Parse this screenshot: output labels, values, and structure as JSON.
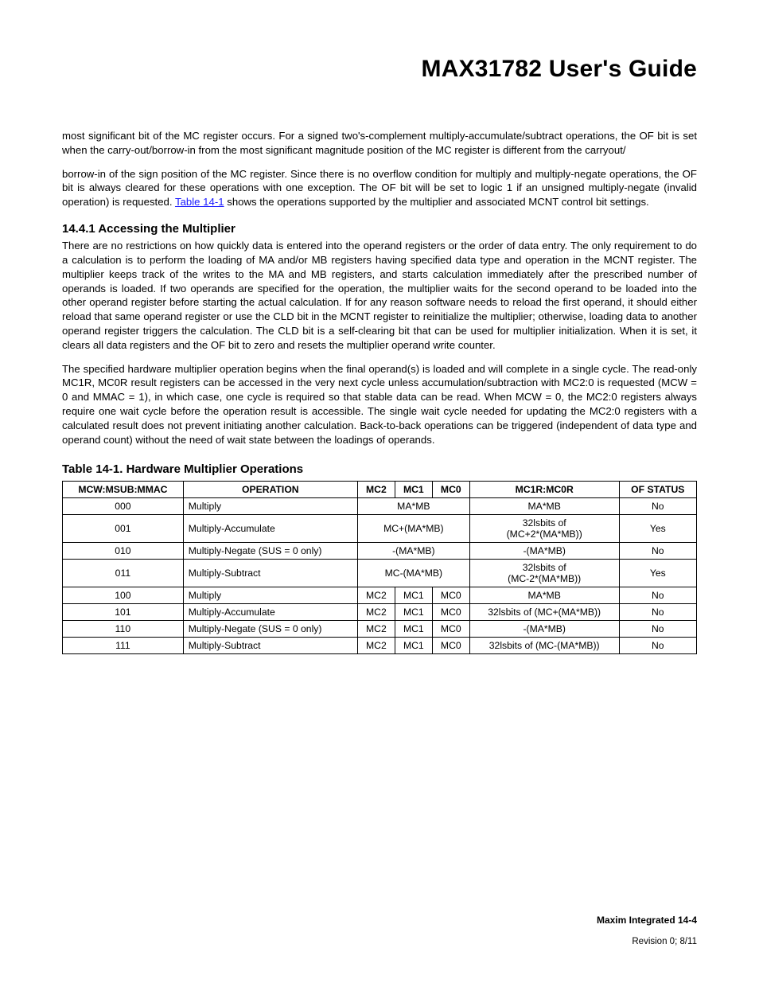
{
  "header": {
    "title": "MAX31782 User's Guide"
  },
  "body": {
    "para1": "most significant bit of the MC register occurs. For a signed two's-complement multiply-accumulate/subtract operations, the OF bit is set when the carry-out/borrow-in from the most significant magnitude position of the MC register is different from the carryout/",
    "para2a": "borrow-in of the sign position of the MC register. Since there is no overflow condition for multiply and multiply-negate operations, the OF bit is always cleared for these operations with one exception. The OF bit will be set to logic 1 if an unsigned multiply-negate (invalid operation) is requested. ",
    "table_link": "Table 14-1",
    "para2b": " shows the operations supported by the multiplier and associated MCNT control bit settings.",
    "section_title": "14.4.1 Accessing the Multiplier",
    "para3": "There are no restrictions on how quickly data is entered into the operand registers or the order of data entry. The only requirement to do a calculation is to perform the loading of MA and/or MB registers having specified data type and operation in the MCNT register. The multiplier keeps track of the writes to the MA and MB registers, and starts calculation immediately after the prescribed number of operands is loaded. If two operands are specified for the operation, the multiplier waits for the second operand to be loaded into the other operand register before starting the actual calculation. If for any reason software needs to reload the first operand, it should either reload that same operand register or use the CLD bit in the MCNT register to reinitialize the multiplier; otherwise, loading data to another operand register triggers the calculation. The CLD bit is a self-clearing bit that can be used for multiplier initialization. When it is set, it clears all data registers and the OF bit to zero and resets the multiplier operand write counter.",
    "para4": "The specified hardware multiplier operation begins when the final operand(s) is loaded and will complete in a single cycle. The read-only MC1R, MC0R result registers can be accessed in the very next cycle unless accumulation/subtraction with MC2:0 is requested (MCW = 0 and MMAC = 1), in which case, one cycle is required so that stable data can be read. When MCW = 0, the MC2:0 registers always require one wait cycle before the operation result is accessible. The single wait cycle needed for updating the MC2:0 registers with a calculated result does not prevent initiating another calculation. Back-to-back operations can be triggered (independent of data type and operand count) without the need of wait state between the loadings of operands."
  },
  "table": {
    "title": "Table 14-1. Hardware Multiplier Operations",
    "headers": {
      "col0": "MCW:MSUB:MMAC",
      "col1": "OPERATION",
      "col2": "MC2",
      "col3": "MC1",
      "col4": "MC0",
      "col5": "MC1R:MC0R",
      "col6": "OF STATUS"
    },
    "rows": [
      {
        "bits": "000",
        "op": "Multiply",
        "mc_span": "MA*MB",
        "mc2": "",
        "mc1": "",
        "mc0": "",
        "mc1r": "MA*MB",
        "of": "No"
      },
      {
        "bits": "001",
        "op": "Multiply-Accumulate",
        "mc_span": "MC+(MA*MB)",
        "mc2": "",
        "mc1": "",
        "mc0": "",
        "mc1r": "32lsbits of\n(MC+2*(MA*MB))",
        "of": "Yes"
      },
      {
        "bits": "010",
        "op": "Multiply-Negate (SUS = 0 only)",
        "mc_span": "-(MA*MB)",
        "mc2": "",
        "mc1": "",
        "mc0": "",
        "mc1r": "-(MA*MB)",
        "of": "No"
      },
      {
        "bits": "011",
        "op": "Multiply-Subtract",
        "mc_span": "MC-(MA*MB)",
        "mc2": "",
        "mc1": "",
        "mc0": "",
        "mc1r": "32lsbits of\n(MC-2*(MA*MB))",
        "of": "Yes"
      },
      {
        "bits": "100",
        "op": "Multiply",
        "mc_span": "",
        "mc2": "MC2",
        "mc1": "MC1",
        "mc0": "MC0",
        "mc1r": "MA*MB",
        "of": "No"
      },
      {
        "bits": "101",
        "op": "Multiply-Accumulate",
        "mc_span": "",
        "mc2": "MC2",
        "mc1": "MC1",
        "mc0": "MC0",
        "mc1r": "32lsbits of (MC+(MA*MB))",
        "of": "No"
      },
      {
        "bits": "110",
        "op": "Multiply-Negate (SUS = 0 only)",
        "mc_span": "",
        "mc2": "MC2",
        "mc1": "MC1",
        "mc0": "MC0",
        "mc1r": "-(MA*MB)",
        "of": "No"
      },
      {
        "bits": "111",
        "op": "Multiply-Subtract",
        "mc_span": "",
        "mc2": "MC2",
        "mc1": "MC1",
        "mc0": "MC0",
        "mc1r": "32lsbits of (MC-(MA*MB))",
        "of": "No"
      }
    ]
  },
  "footer": {
    "line1": "Maxim Integrated   14-4",
    "line2": "Revision 0; 8/11"
  }
}
